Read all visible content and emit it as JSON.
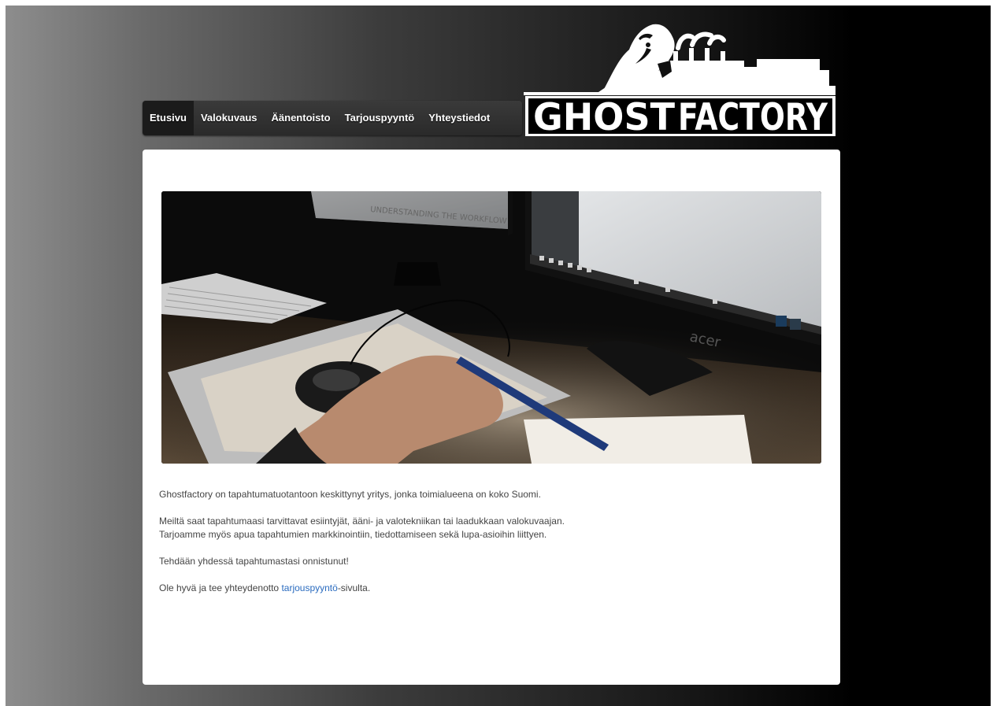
{
  "nav": {
    "items": [
      {
        "label": "Etusivu",
        "active": true
      },
      {
        "label": "Valokuvaus",
        "active": false
      },
      {
        "label": "Äänentoisto",
        "active": false
      },
      {
        "label": "Tarjouspyyntö",
        "active": false
      },
      {
        "label": "Yhteystiedot",
        "active": false
      }
    ]
  },
  "logo": {
    "text": "GHOSTFACTORY",
    "part1": "GHOST",
    "part2": "FACTORY"
  },
  "hero": {
    "monitor_text": "UNDERSTANDING THE WORKFLOW",
    "brand": "acer"
  },
  "content": {
    "p1": "Ghostfactory on tapahtumatuotantoon keskittynyt yritys, jonka toimialueena on koko Suomi.",
    "p2_line1": "Meiltä saat tapahtumaasi tarvittavat esiintyjät, ääni- ja valotekniikan tai laadukkaan valokuvaajan.",
    "p2_line2": "Tarjoamme myös apua tapahtumien markkinointiin, tiedottamiseen sekä lupa-asioihin liittyen.",
    "p3": "Tehdään yhdessä tapahtumastasi onnistunut!",
    "p4_before": "Ole hyvä ja tee yhteydenotto ",
    "p4_link": "tarjouspyyntö",
    "p4_after": "-sivulta."
  },
  "colors": {
    "link": "#2a6bbf",
    "text": "#444444",
    "nav_bg": "#333333",
    "nav_active": "#1b1b1b"
  }
}
